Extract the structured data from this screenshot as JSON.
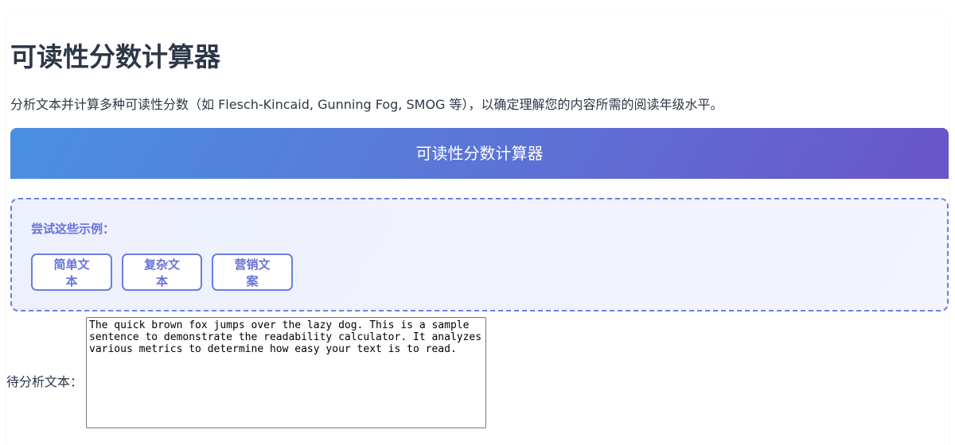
{
  "page": {
    "title": "可读性分数计算器",
    "description": "分析文本并计算多种可读性分数（如 Flesch-Kincaid, Gunning Fog, SMOG 等），以确定理解您的内容所需的阅读年级水平。"
  },
  "tool": {
    "banner_title": "可读性分数计算器",
    "examples": {
      "label": "尝试这些示例：",
      "buttons": [
        "简单文本",
        "复杂文本",
        "营销文案"
      ]
    },
    "text_field": {
      "label": "待分析文本：",
      "value": "The quick brown fox jumps over the lazy dog. This is a sample sentence to demonstrate the readability calculator. It analyzes various metrics to determine how easy your text is to read."
    }
  },
  "colors": {
    "banner_gradient_start": "#4a90e2",
    "banner_gradient_end": "#6a55c9",
    "accent": "#6674d9",
    "text": "#2d3748"
  }
}
